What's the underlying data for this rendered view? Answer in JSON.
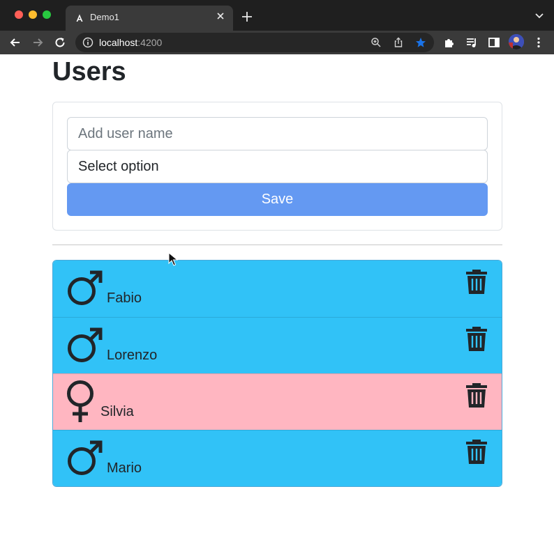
{
  "browser": {
    "tab_title": "Demo1",
    "url_host": "localhost",
    "url_port": ":4200",
    "accent_color": "#1a73e8"
  },
  "page": {
    "title": "Users",
    "form": {
      "name_placeholder": "Add user name",
      "select_value": "Select option",
      "save_label": "Save",
      "save_color": "#6499f2"
    },
    "users": [
      {
        "name": "Fabio",
        "gender": "male",
        "color": "#31c2f7"
      },
      {
        "name": "Lorenzo",
        "gender": "male",
        "color": "#31c2f7"
      },
      {
        "name": "Silvia",
        "gender": "female",
        "color": "#ffb6c1"
      },
      {
        "name": "Mario",
        "gender": "male",
        "color": "#31c2f7"
      }
    ]
  },
  "icons": [
    "angular-icon",
    "close-icon",
    "plus-icon",
    "chevron-down-icon",
    "back-icon",
    "forward-icon",
    "reload-icon",
    "info-icon",
    "zoom-icon",
    "share-icon",
    "star-icon",
    "extensions-icon",
    "media-icon",
    "sidebar-icon",
    "avatar",
    "menu-icon",
    "male-icon",
    "female-icon",
    "trash-icon"
  ]
}
